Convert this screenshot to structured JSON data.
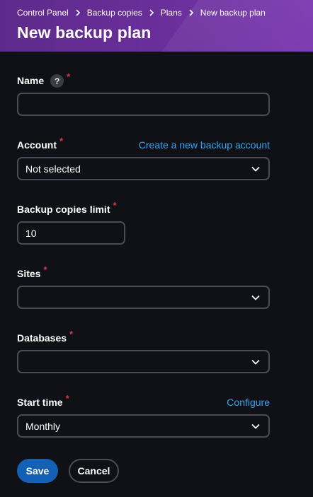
{
  "breadcrumb": [
    "Control Panel",
    "Backup copies",
    "Plans",
    "New backup plan"
  ],
  "page_title": "New backup plan",
  "required_marker": "*",
  "fields": {
    "name": {
      "label": "Name",
      "help": "?",
      "value": ""
    },
    "account": {
      "label": "Account",
      "value": "Not selected",
      "link": "Create a new backup account"
    },
    "backup_copies_limit": {
      "label": "Backup copies limit",
      "value": "10"
    },
    "sites": {
      "label": "Sites",
      "value": ""
    },
    "databases": {
      "label": "Databases",
      "value": ""
    },
    "start_time": {
      "label": "Start time",
      "value": "Monthly",
      "link": "Configure"
    }
  },
  "actions": {
    "save": "Save",
    "cancel": "Cancel"
  },
  "colors": {
    "header": "#6b2f9c",
    "background": "#0f1116",
    "link": "#2fa6ef",
    "required": "#e0364a",
    "primary_button": "#1460b4",
    "border": "#4a4d56"
  },
  "icons": {
    "separator": "chevron-right-icon",
    "dropdown": "chevron-down-icon"
  }
}
